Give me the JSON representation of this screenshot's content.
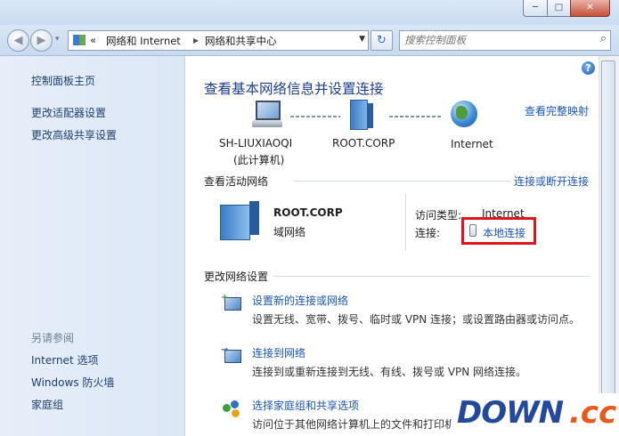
{
  "window": {
    "controls": {
      "minimize": "─",
      "maximize": "□",
      "close": "✕"
    }
  },
  "nav": {
    "back_glyph": "◀",
    "forward_glyph": "▶",
    "history_glyph": "▾",
    "breadcrumb_prefix": "«",
    "breadcrumbs": [
      "网络和 Internet",
      "网络和共享中心"
    ],
    "separator": "▶",
    "dropdown_glyph": "▼",
    "refresh_glyph": "↻",
    "search_placeholder": "搜索控制面板",
    "search_icon": "search-icon"
  },
  "sidebar": {
    "items": [
      "控制面板主页",
      "更改适配器设置",
      "更改高级共享设置"
    ],
    "see_also_heading": "另请参阅",
    "see_also": [
      "Internet 选项",
      "Windows 防火墙",
      "家庭组"
    ]
  },
  "main": {
    "help": "?",
    "title": "查看基本网络信息并设置连接",
    "full_map_link": "查看完整映射",
    "map": {
      "computer_name": "SH-LIUXIAOQI",
      "computer_sub": "(此计算机)",
      "domain": "ROOT.CORP",
      "internet": "Internet"
    },
    "active": {
      "heading": "查看活动网络",
      "connect_link": "连接或断开连接",
      "network_name": "ROOT.CORP",
      "network_type": "域网络",
      "access_type_label": "访问类型:",
      "access_type_value": "Internet",
      "connections_label": "连接:",
      "connection_value": "本地连接"
    },
    "change": {
      "heading": "更改网络设置",
      "tasks": [
        {
          "title": "设置新的连接或网络",
          "desc": "设置无线、宽带、拨号、临时或 VPN 连接；或设置路由器或访问点。"
        },
        {
          "title": "连接到网络",
          "desc": "连接到或重新连接到无线、有线、拨号或 VPN 网络连接。"
        },
        {
          "title": "选择家庭组和共享选项",
          "desc": "访问位于其他网络计算机上的文件和打印机，或"
        }
      ]
    }
  },
  "watermark": {
    "part1": "DOWN",
    "part2": ".cc"
  },
  "colors": {
    "link": "#1a56b4",
    "title": "#1e3f8a",
    "highlight": "#e0141e",
    "sidebar_bg": "#e2ebf8"
  }
}
